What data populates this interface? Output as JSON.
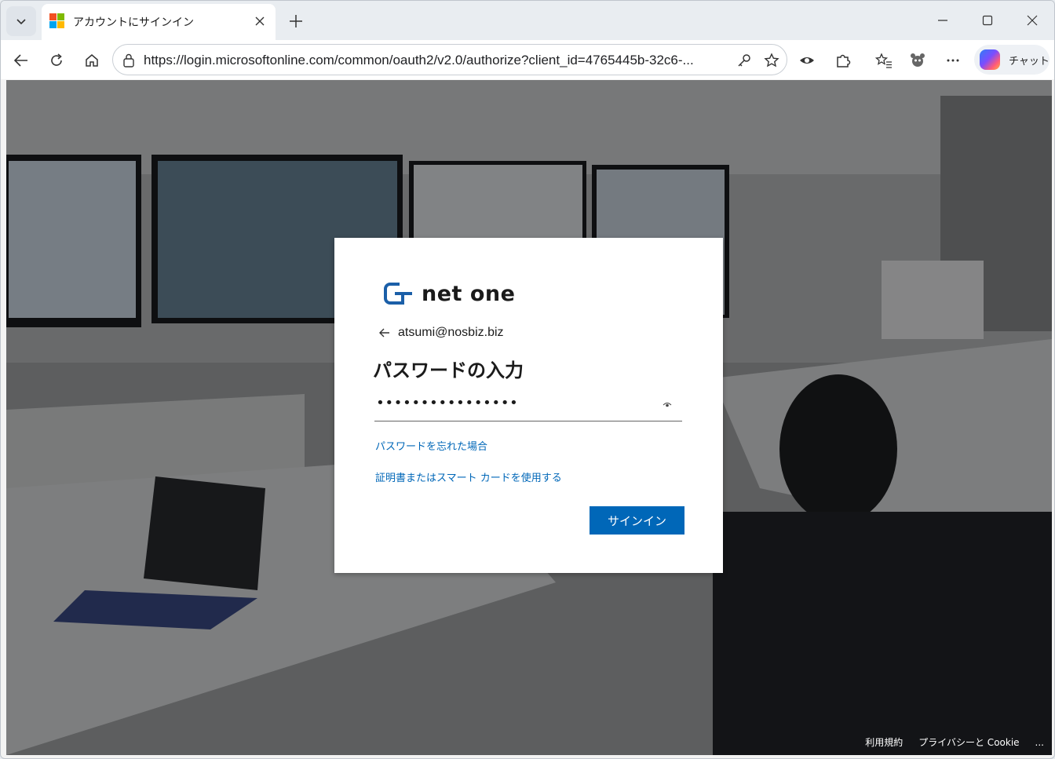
{
  "browser": {
    "tab_title": "アカウントにサインイン",
    "url": "https://login.microsoftonline.com/common/oauth2/v2.0/authorize?client_id=4765445b-32c6-...",
    "copilot_label": "チャット",
    "favicon_colors": [
      "#f25022",
      "#7fba00",
      "#00a4ef",
      "#ffb900"
    ]
  },
  "signin": {
    "brand": "net one",
    "identity_email": "atsumi@nosbiz.biz",
    "heading": "パスワードの入力",
    "password_mask": "••••••••••••••••",
    "forgot_password": "パスワードを忘れた場合",
    "certificate_link": "証明書またはスマート カードを使用する",
    "signin_button": "サインイン",
    "accent_color": "#0067b8"
  },
  "footer": {
    "terms": "利用規約",
    "privacy": "プライバシーと Cookie",
    "more": "..."
  }
}
